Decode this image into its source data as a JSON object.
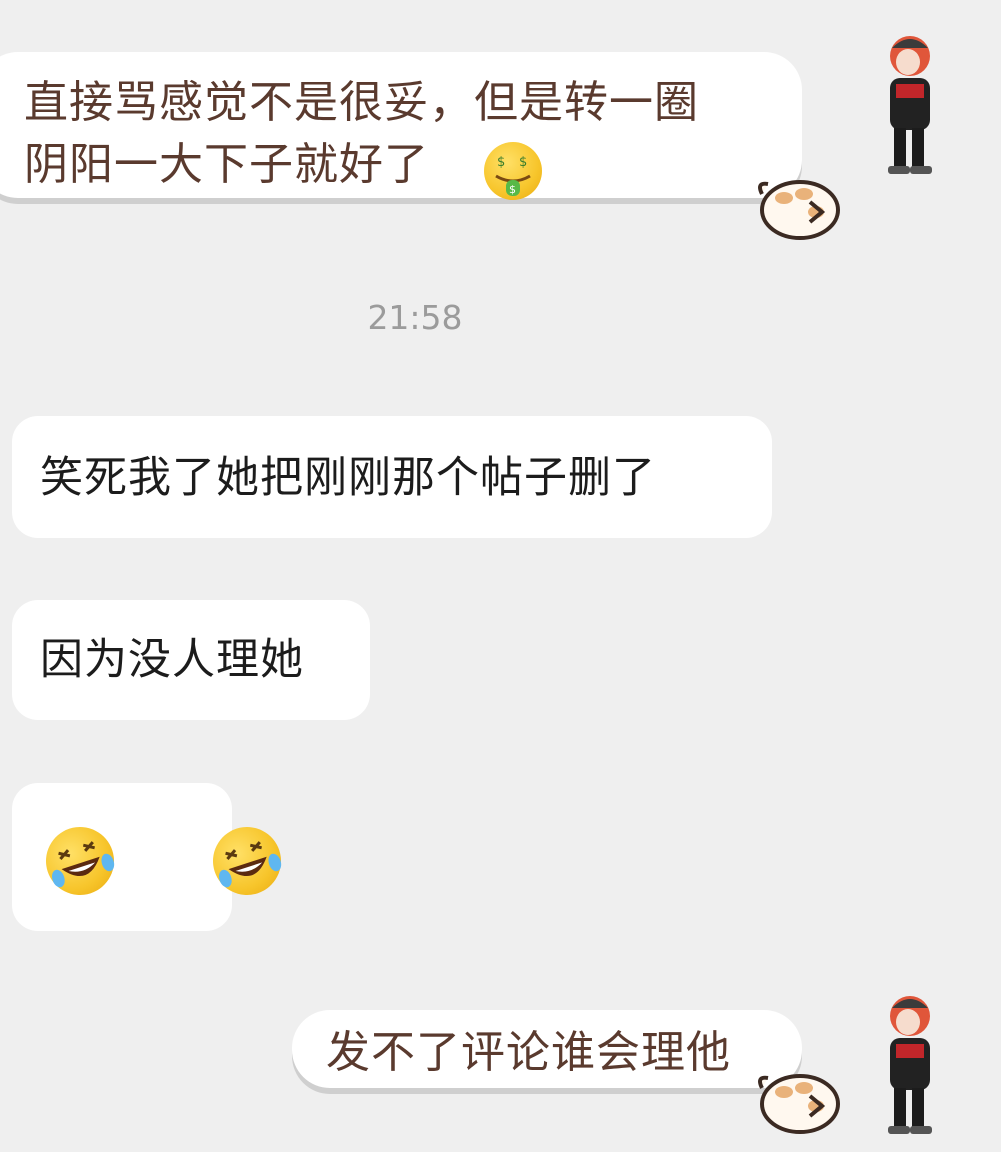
{
  "messages": [
    {
      "side": "sent",
      "line1": "直接骂感觉不是很妥，但是转一圈",
      "line2": "阴阳一大下子就好了",
      "emoji": "money-mouth-face"
    },
    {
      "type": "timestamp",
      "text": "21:58"
    },
    {
      "side": "received",
      "text": "笑死我了她把刚刚那个帖子删了"
    },
    {
      "side": "received",
      "text": "因为没人理她"
    },
    {
      "side": "received",
      "emojis": [
        "rolling-on-floor-laughing",
        "rolling-on-floor-laughing"
      ]
    },
    {
      "side": "sent",
      "text": "发不了评论谁会理他"
    }
  ],
  "colors": {
    "background": "#efefef",
    "bubble": "#ffffff",
    "sent_text": "#5a3a2e",
    "received_text": "#1c1c1c",
    "timestamp": "#9b9b9b"
  }
}
